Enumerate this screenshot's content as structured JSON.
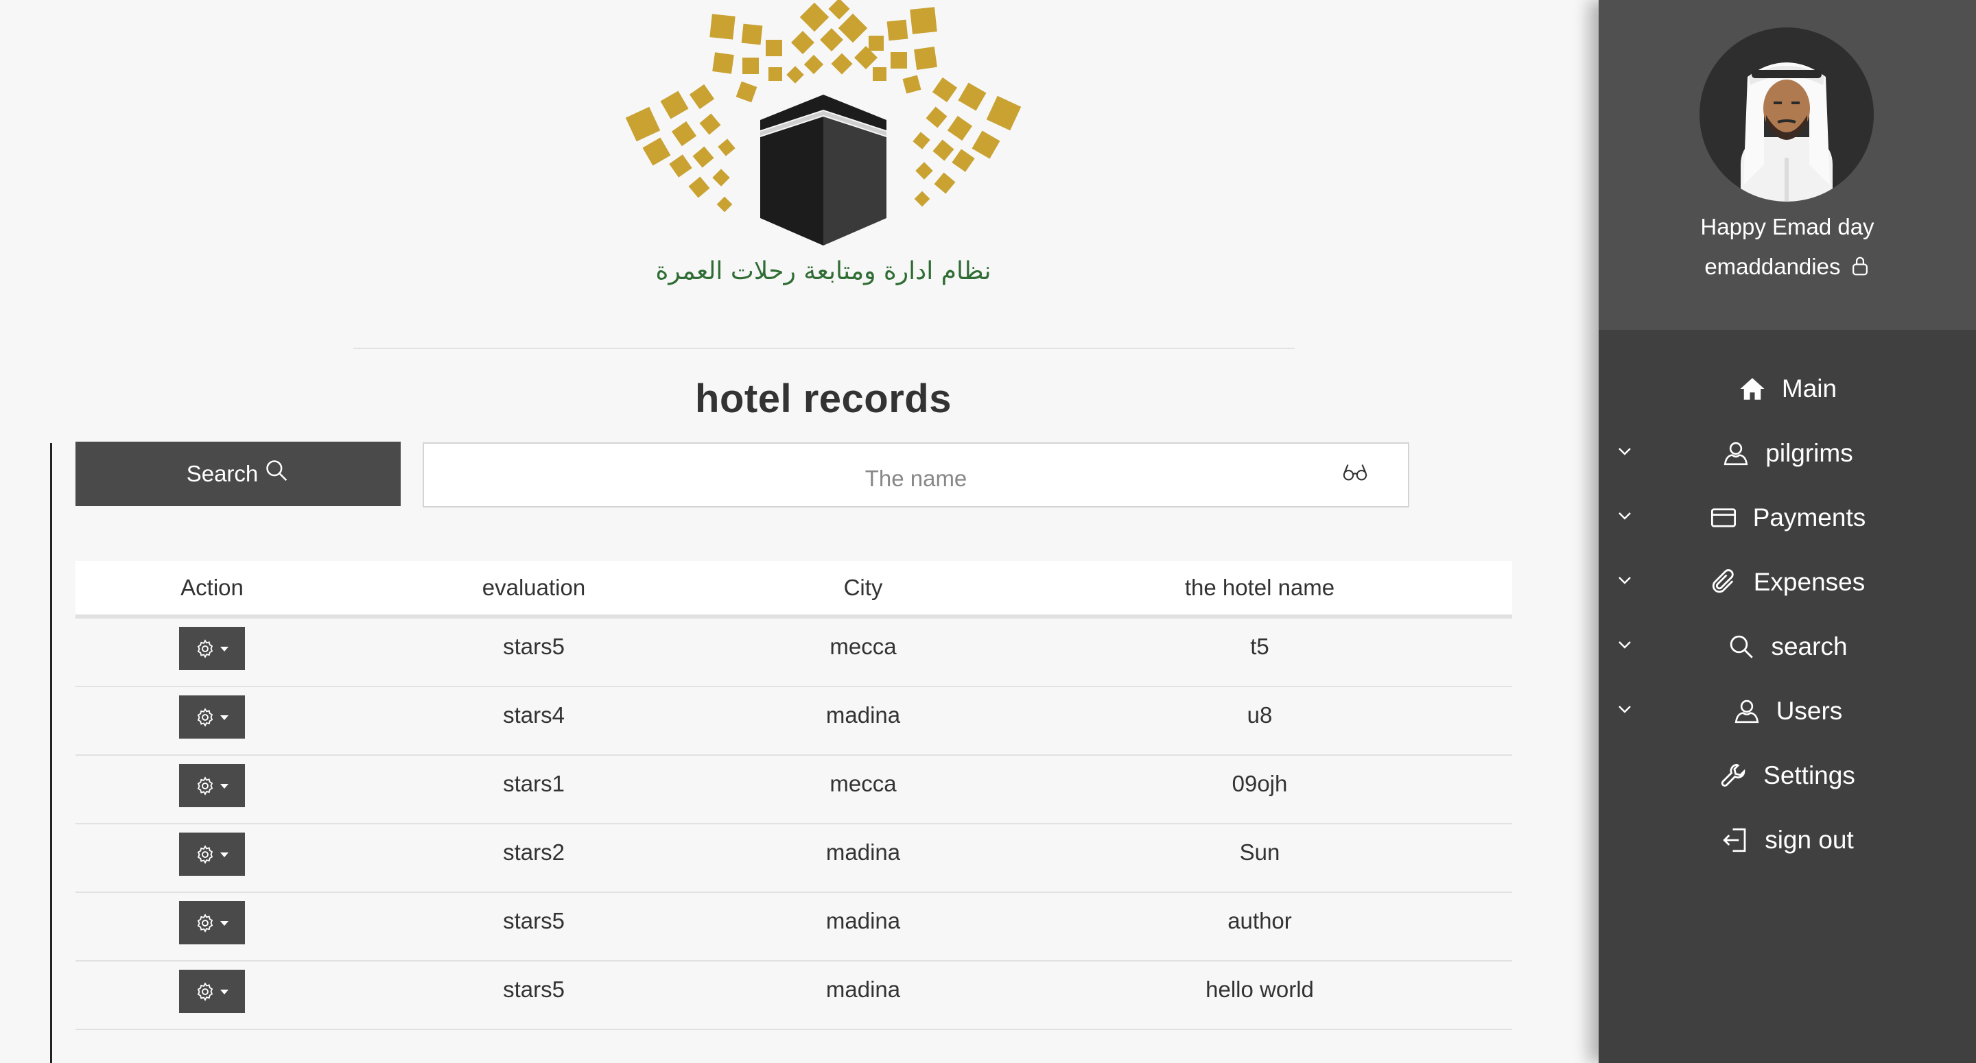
{
  "logo": {
    "tagline": "نظام ادارة ومتابعة رحلات العمرة",
    "colors": {
      "gold": "#c9a232",
      "kaaba": "#1c1c1c",
      "green": "#2f6d34"
    }
  },
  "page": {
    "title": "hotel records"
  },
  "search": {
    "button_label": "Search",
    "button_icon": "search-icon",
    "input_placeholder": "The name",
    "input_value": "",
    "input_icon": "glasses-icon"
  },
  "table": {
    "headers": {
      "action": "Action",
      "evaluation": "evaluation",
      "city": "City",
      "hotel_name": "the hotel name"
    },
    "rows": [
      {
        "evaluation": "stars5",
        "city": "mecca",
        "hotel_name": "t5"
      },
      {
        "evaluation": "stars4",
        "city": "madina",
        "hotel_name": "u8"
      },
      {
        "evaluation": "stars1",
        "city": "mecca",
        "hotel_name": "09ojh"
      },
      {
        "evaluation": "stars2",
        "city": "madina",
        "hotel_name": "Sun"
      },
      {
        "evaluation": "stars5",
        "city": "madina",
        "hotel_name": "author"
      },
      {
        "evaluation": "stars5",
        "city": "madina",
        "hotel_name": "hello world"
      }
    ]
  },
  "sidebar": {
    "greeting": "Happy Emad day",
    "username": "emaddandies",
    "nav": [
      {
        "label": "Main",
        "icon": "home-icon",
        "expandable": false
      },
      {
        "label": "pilgrims",
        "icon": "user-icon",
        "expandable": true
      },
      {
        "label": "Payments",
        "icon": "credit-card-icon",
        "expandable": true
      },
      {
        "label": "Expenses",
        "icon": "paperclip-icon",
        "expandable": true
      },
      {
        "label": "search",
        "icon": "search-icon",
        "expandable": true
      },
      {
        "label": "Users",
        "icon": "user-icon",
        "expandable": true
      },
      {
        "label": "Settings",
        "icon": "wrench-icon",
        "expandable": false
      },
      {
        "label": "sign out",
        "icon": "sign-out-icon",
        "expandable": false
      }
    ]
  },
  "colors": {
    "background": "#f7f7f7",
    "sidebar": "#404040",
    "sidebar_profile": "#505050",
    "button": "#4a4a4a"
  }
}
